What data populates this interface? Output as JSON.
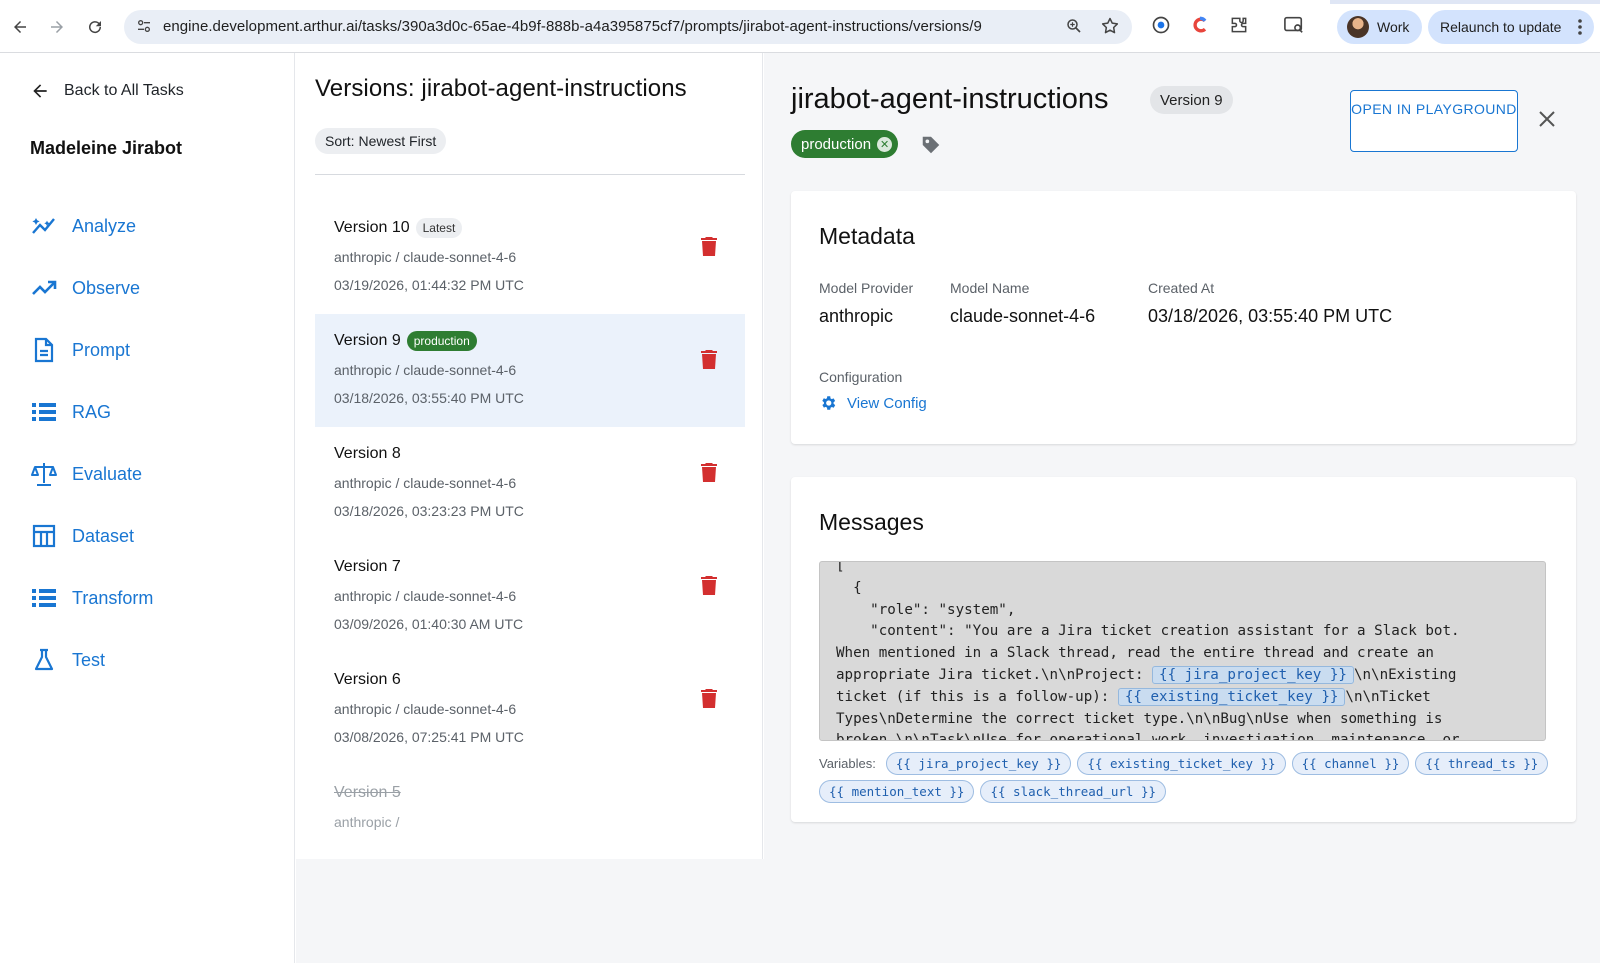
{
  "browser": {
    "url": "engine.development.arthur.ai/tasks/390a3d0c-65ae-4b9f-888b-a4a395875cf7/prompts/jirabot-agent-instructions/versions/9",
    "profile_label": "Work",
    "relaunch_label": "Relaunch to update"
  },
  "sidebar": {
    "back_label": "Back to All Tasks",
    "task_name": "Madeleine Jirabot",
    "items": [
      {
        "label": "Analyze",
        "icon": "analytics-icon"
      },
      {
        "label": "Observe",
        "icon": "trending-up-icon"
      },
      {
        "label": "Prompt",
        "icon": "document-icon"
      },
      {
        "label": "RAG",
        "icon": "list-icon"
      },
      {
        "label": "Evaluate",
        "icon": "scale-icon"
      },
      {
        "label": "Dataset",
        "icon": "table-icon"
      },
      {
        "label": "Transform",
        "icon": "list-icon"
      },
      {
        "label": "Test",
        "icon": "flask-icon"
      }
    ]
  },
  "versions": {
    "title": "Versions: jirabot-agent-instructions",
    "sort_label": "Sort: Newest First",
    "items": [
      {
        "name": "Version 10",
        "tag": "Latest",
        "model": "anthropic / claude-sonnet-4-6",
        "date": "03/19/2026, 01:44:32 PM UTC"
      },
      {
        "name": "Version 9",
        "tag": "production",
        "model": "anthropic / claude-sonnet-4-6",
        "date": "03/18/2026, 03:55:40 PM UTC"
      },
      {
        "name": "Version 8",
        "tag": "",
        "model": "anthropic / claude-sonnet-4-6",
        "date": "03/18/2026, 03:23:23 PM UTC"
      },
      {
        "name": "Version 7",
        "tag": "",
        "model": "anthropic / claude-sonnet-4-6",
        "date": "03/09/2026, 01:40:30 AM UTC"
      },
      {
        "name": "Version 6",
        "tag": "",
        "model": "anthropic / claude-sonnet-4-6",
        "date": "03/08/2026, 07:25:41 PM UTC"
      },
      {
        "name": "Version 5",
        "tag": "",
        "model": "anthropic /",
        "date": ""
      }
    ]
  },
  "detail": {
    "title": "jirabot-agent-instructions",
    "version_chip": "Version 9",
    "tag_chip": "production",
    "open_button": "OPEN IN PLAYGROUND",
    "metadata": {
      "title": "Metadata",
      "provider_label": "Model Provider",
      "provider_value": "anthropic",
      "model_label": "Model Name",
      "model_value": "claude-sonnet-4-6",
      "created_label": "Created At",
      "created_value": "03/18/2026, 03:55:40 PM UTC",
      "config_label": "Configuration",
      "view_config": "View Config"
    },
    "messages": {
      "title": "Messages",
      "code_lines": [
        [
          "[",
          ""
        ],
        [
          "  {",
          ""
        ],
        [
          "    \"role\": \"system\",",
          ""
        ],
        [
          "    \"content\": \"You are a Jira ticket creation assistant for a Slack bot.",
          ""
        ],
        [
          "When mentioned in a Slack thread, read the entire thread and create an",
          ""
        ],
        [
          "appropriate Jira ticket.\\n\\nProject: ",
          "{{ jira_project_key }}",
          "\\n\\nExisting"
        ],
        [
          "ticket (if this is a follow-up): ",
          "{{ existing_ticket_key }}",
          "\\n\\nTicket"
        ],
        [
          "Types\\nDetermine the correct ticket type.\\n\\nBug\\nUse when something is",
          ""
        ],
        [
          "broken.\\n\\nTask\\nUse for operational work, investigation, maintenance, or",
          ""
        ]
      ],
      "variables_label": "Variables:",
      "variables": [
        "{{ jira_project_key }}",
        "{{ existing_ticket_key }}",
        "{{ channel }}",
        "{{ thread_ts }}",
        "{{ mention_text }}",
        "{{ slack_thread_url }}"
      ]
    }
  },
  "colors": {
    "accent": "#1976d2",
    "production": "#2e7d32",
    "delete": "#d32f2f",
    "selected_row": "#ebf2fb"
  }
}
